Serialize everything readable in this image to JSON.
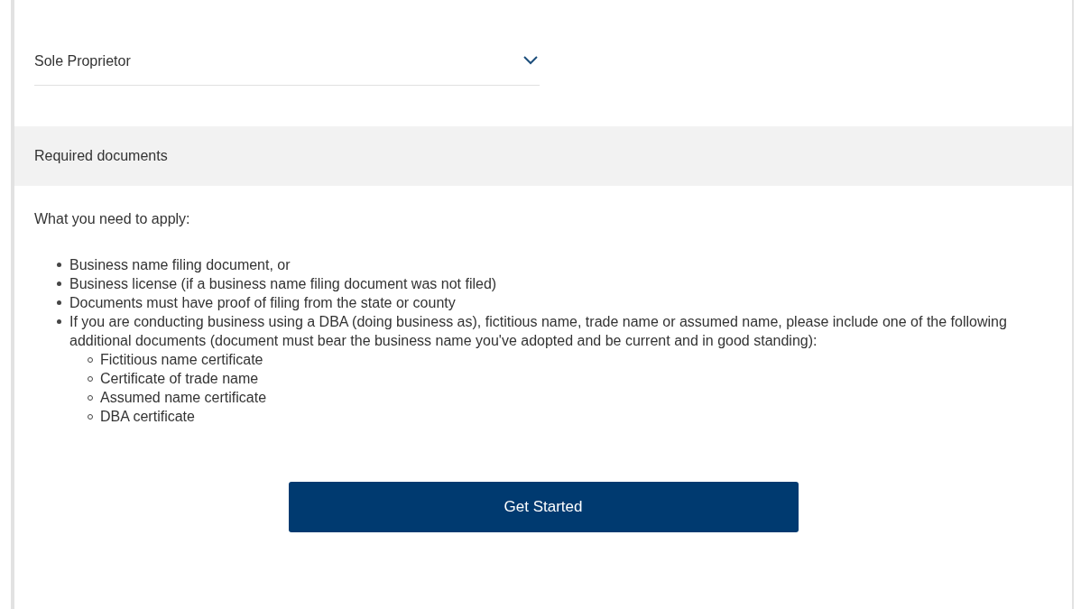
{
  "dropdown": {
    "value": "Sole Proprietor"
  },
  "section": {
    "heading": "Required documents"
  },
  "intro": "What you need to apply:",
  "items": [
    {
      "text": "Business name filing document, or"
    },
    {
      "text": "Business license (if a business name filing document was not filed)"
    },
    {
      "text": "Documents must have proof of filing from the state or county"
    },
    {
      "text": "If you are conducting business using a DBA (doing business as), fictitious name, trade name or assumed name, please include one of the following additional documents (document must bear the business name you've adopted and be current and in good standing):",
      "children": [
        {
          "text": "Fictitious name certificate"
        },
        {
          "text": "Certificate of trade name"
        },
        {
          "text": "Assumed name certificate"
        },
        {
          "text": "DBA certificate"
        }
      ]
    }
  ],
  "button": "Get Started"
}
